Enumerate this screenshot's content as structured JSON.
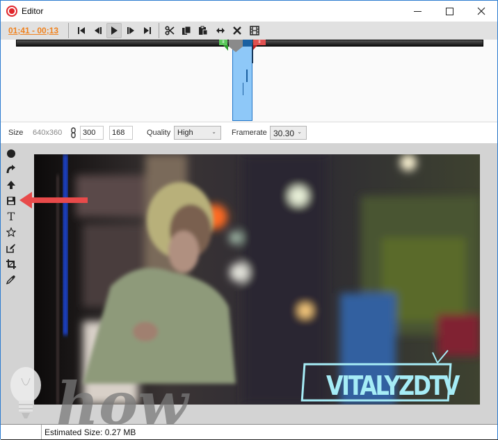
{
  "window": {
    "title": "Editor",
    "app_icon": "record-icon",
    "controls": {
      "minimize": "minimize-icon",
      "maximize": "maximize-icon",
      "close": "close-icon"
    }
  },
  "toolbar": {
    "timecode": "01;41 - 00;13",
    "timecode_color": "#f0821e",
    "playback": [
      {
        "name": "skip-to-start",
        "icon": "skip-start-icon"
      },
      {
        "name": "previous-frame",
        "icon": "step-back-icon"
      },
      {
        "name": "play",
        "icon": "play-icon",
        "active": true
      },
      {
        "name": "next-frame",
        "icon": "step-forward-icon"
      },
      {
        "name": "skip-to-end",
        "icon": "skip-end-icon"
      }
    ],
    "editing": [
      {
        "name": "cut",
        "icon": "scissors-icon"
      },
      {
        "name": "copy",
        "icon": "copy-icon"
      },
      {
        "name": "paste",
        "icon": "paste-icon"
      },
      {
        "name": "resize",
        "icon": "resize-arrows-icon"
      },
      {
        "name": "delete",
        "icon": "delete-x-icon"
      },
      {
        "name": "frames",
        "icon": "film-icon"
      }
    ]
  },
  "timeline": {
    "selection_color": "#8ec8f8",
    "start_marker_color": "#5bc85b",
    "end_marker_color": "#e05050"
  },
  "options": {
    "size_label": "Size",
    "original_size": "640x360",
    "link_icon": "chain-link-icon",
    "width_value": "300",
    "height_value": "168",
    "quality_label": "Quality",
    "quality_value": "High",
    "framerate_label": "Framerate",
    "framerate_value": "30.30"
  },
  "side_tools": [
    {
      "name": "record",
      "icon": "circle-icon"
    },
    {
      "name": "redo",
      "icon": "redo-arrow-icon"
    },
    {
      "name": "upload",
      "icon": "up-arrow-icon"
    },
    {
      "name": "save",
      "icon": "floppy-disk-icon"
    },
    {
      "name": "text",
      "icon": "text-t-icon"
    },
    {
      "name": "favorite",
      "icon": "star-icon"
    },
    {
      "name": "edit",
      "icon": "edit-pencil-icon"
    },
    {
      "name": "crop",
      "icon": "crop-icon"
    },
    {
      "name": "eyedropper",
      "icon": "eyedropper-icon"
    }
  ],
  "video": {
    "watermark_text": "VITALYZDTV",
    "annotation": "red-arrow-pointing-to-save"
  },
  "overlay": {
    "watermark_text": "how"
  },
  "status": {
    "estimated_size": "Estimated Size: 0.27 MB"
  }
}
